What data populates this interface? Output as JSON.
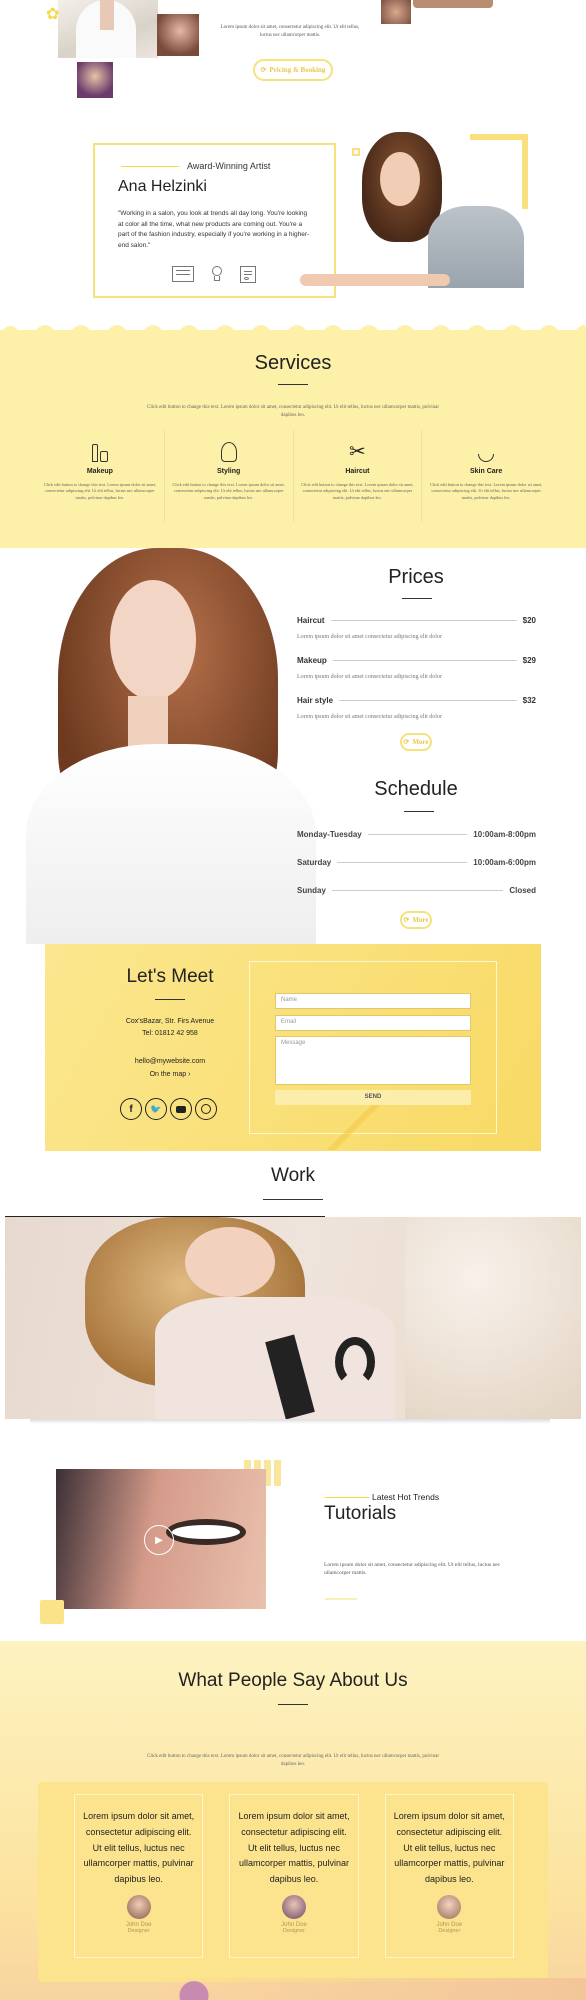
{
  "hero": {
    "desc": "Lorem ipsum dolor sit amet, consectetur adipiscing elit. Ut elit tellus, luctus nec ullamcorper mattis.",
    "button": "Pricing & Booking"
  },
  "artist": {
    "kicker": "Award-Winning Artist",
    "name": "Ana Helzinki",
    "quote": "\"Working in a salon, you look at trends all day long. You're looking at color all the time, what new products are coming out. You're a part of the fashion industry, especially if you're working in a higher-end salon.\""
  },
  "services": {
    "title": "Services",
    "desc": "Click edit button to change this text. Lorem ipsum dolor sit amet, consectetur adipiscing elit. Ut elit tellus, luctus nec ullamcorper mattis, pulvinar dapibus leo.",
    "items": [
      {
        "name": "Makeup",
        "icon": "makeup-icon",
        "text": "Click edit button to change this text. Lorem ipsum dolor sit amet, consectetur adipiscing elit. Ut elit tellus, luctus nec ullamcorper mattis, pulvinar dapibus leo."
      },
      {
        "name": "Styling",
        "icon": "styling-icon",
        "text": "Click edit button to change this text. Lorem ipsum dolor sit amet, consectetur adipiscing elit. Ut elit tellus, luctus nec ullamcorper mattis, pulvinar dapibus leo."
      },
      {
        "name": "Haircut",
        "icon": "scissors-icon",
        "text": "Click edit button to change this text. Lorem ipsum dolor sit amet, consectetur adipiscing elit. Ut elit tellus, luctus nec ullamcorper mattis, pulvinar dapibus leo."
      },
      {
        "name": "Skin Care",
        "icon": "skincare-icon",
        "text": "Click edit button to change this text. Lorem ipsum dolor sit amet, consectetur adipiscing elit. Ut elit tellus, luctus nec ullamcorper mattis, pulvinar dapibus leo."
      }
    ]
  },
  "prices": {
    "title": "Prices",
    "items": [
      {
        "name": "Haircut",
        "price": "$20",
        "desc": "Lorem ipsum dolor sit amet consectetur adipiscing elit dolor"
      },
      {
        "name": "Makeup",
        "price": "$29",
        "desc": "Lorem ipsum dolor sit amet consectetur adipiscing elit dolor"
      },
      {
        "name": "Hair style",
        "price": "$32",
        "desc": "Lorem ipsum dolor sit amet consectetur adipiscing elit dolor"
      }
    ],
    "more": "More"
  },
  "schedule": {
    "title": "Schedule",
    "rows": [
      {
        "day": "Monday-Tuesday",
        "hours": "10:00am-8:00pm"
      },
      {
        "day": "Saturday",
        "hours": "10:00am-6:00pm"
      },
      {
        "day": "Sunday",
        "hours": "Closed"
      }
    ],
    "more": "More"
  },
  "meet": {
    "title": "Let's Meet",
    "address": "Cox'sBazar, Str. Firs Avenue",
    "tel": "Tel: 01812 42 958",
    "email": "hello@mywebsite.com",
    "map": "On the map ›",
    "form": {
      "name": "Name",
      "email": "Email",
      "message": "Message",
      "send": "SEND"
    }
  },
  "work": {
    "title": "Work"
  },
  "tutorials": {
    "kicker": "Latest Hot Trends",
    "title": "Tutorials",
    "desc": "Lorem ipsum dolor sit amet, consectetur adipiscing elit. Ut elit tellus, luctus nec ullamcorper mattis."
  },
  "testimonials": {
    "title": "What People Say About Us",
    "desc": "Click edit button to change this text. Lorem ipsum dolor sit amet, consectetur adipiscing elit. Ut elit tellus, luctus nec ullamcorper mattis, pulvinar dapibus leo.",
    "items": [
      {
        "text": "Lorem ipsum dolor sit amet, consectetur adipiscing elit. Ut elit tellus, luctus nec ullamcorper mattis, pulvinar dapibus leo.",
        "name": "John Doe",
        "role": "Designer"
      },
      {
        "text": "Lorem ipsum dolor sit amet, consectetur adipiscing elit. Ut elit tellus, luctus nec ullamcorper mattis, pulvinar dapibus leo.",
        "name": "John Doe",
        "role": "Designer"
      },
      {
        "text": "Lorem ipsum dolor sit amet, consectetur adipiscing elit. Ut elit tellus, luctus nec ullamcorper mattis, pulvinar dapibus leo.",
        "name": "John Doe",
        "role": "Designer"
      }
    ]
  },
  "colors": {
    "accent": "#fdf0a8",
    "accent_dark": "#f6d94a",
    "button": "#e9c84a"
  }
}
